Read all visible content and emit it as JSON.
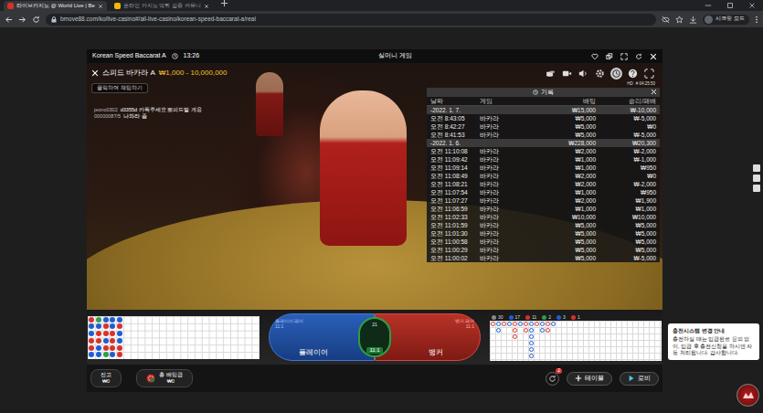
{
  "browser": {
    "tabs": [
      {
        "label": "라이브카지노 @ World Live | Be",
        "selected": true
      },
      {
        "label": "온라인 카지노 먹튀 검증 커뮤니",
        "selected": false
      }
    ],
    "url": "bmove88.com/ko/live-casino#/all-live-casino/korean-speed-baccarat-a/real",
    "profile": "시크릿 모드"
  },
  "game_header": {
    "title": "Korean Speed Baccarat A",
    "time": "13:26",
    "mode": "실머니 게임"
  },
  "table": {
    "name": "스피드 바카라 A",
    "limits": "₩1,000 - 10,000,000"
  },
  "chat": {
    "button": "클릭하여 채팅하기",
    "messages": [
      {
        "user": "jeono0302",
        "text": "d3355d 카톡주세요 뽀피드발 게용"
      },
      {
        "user": "00000087/5",
        "text": "나와라 좀"
      }
    ]
  },
  "stream": {
    "quality": "HD",
    "code": "# 04:25:50"
  },
  "history": {
    "open": true,
    "title": "기록",
    "columns": [
      "날짜",
      "게임",
      "배팅",
      "승리/패배"
    ],
    "rows": [
      {
        "kind": "group",
        "date": "-2022. 1. 7.",
        "bet": "₩15,000",
        "result": "₩-10,000"
      },
      {
        "kind": "entry",
        "time": "오전 8:43:05",
        "game": "바카라",
        "bet": "₩5,000",
        "result": "₩-5,000"
      },
      {
        "kind": "entry",
        "time": "오전 8:42:27",
        "game": "바카라",
        "bet": "₩5,000",
        "result": "₩0"
      },
      {
        "kind": "entry",
        "time": "오전 8:41:53",
        "game": "바카라",
        "bet": "₩5,000",
        "result": "₩-5,000"
      },
      {
        "kind": "group",
        "date": "-2022. 1. 6.",
        "bet": "₩228,000",
        "result": "₩20,300"
      },
      {
        "kind": "entry",
        "time": "오전 11:10:08",
        "game": "바카라",
        "bet": "₩2,000",
        "result": "₩-2,000"
      },
      {
        "kind": "entry",
        "time": "오전 11:09:42",
        "game": "바카라",
        "bet": "₩1,000",
        "result": "₩-1,000"
      },
      {
        "kind": "entry",
        "time": "오전 11:09:14",
        "game": "바카라",
        "bet": "₩1,000",
        "result": "₩950"
      },
      {
        "kind": "entry",
        "time": "오전 11:08:49",
        "game": "바카라",
        "bet": "₩2,000",
        "result": "₩0"
      },
      {
        "kind": "entry",
        "time": "오전 11:08:21",
        "game": "바카라",
        "bet": "₩2,000",
        "result": "₩-2,000"
      },
      {
        "kind": "entry",
        "time": "오전 11:07:54",
        "game": "바카라",
        "bet": "₩1,000",
        "result": "₩950"
      },
      {
        "kind": "entry",
        "time": "오전 11:07:27",
        "game": "바카라",
        "bet": "₩2,000",
        "result": "₩1,900"
      },
      {
        "kind": "entry",
        "time": "오전 11:06:59",
        "game": "바카라",
        "bet": "₩1,000",
        "result": "₩1,000"
      },
      {
        "kind": "entry",
        "time": "오전 11:02:33",
        "game": "바카라",
        "bet": "₩10,000",
        "result": "₩10,000"
      },
      {
        "kind": "entry",
        "time": "오전 11:01:59",
        "game": "바카라",
        "bet": "₩5,000",
        "result": "₩5,000"
      },
      {
        "kind": "entry",
        "time": "오전 11:01:30",
        "game": "바카라",
        "bet": "₩5,000",
        "result": "₩5,000"
      },
      {
        "kind": "entry",
        "time": "오전 11:00:58",
        "game": "바카라",
        "bet": "₩5,000",
        "result": "₩5,000"
      },
      {
        "kind": "entry",
        "time": "오전 11:00:29",
        "game": "바카라",
        "bet": "₩5,000",
        "result": "₩5,000"
      },
      {
        "kind": "entry",
        "time": "오전 11:00:02",
        "game": "바카라",
        "bet": "₩5,000",
        "result": "₩-5,000"
      }
    ]
  },
  "bead_road": [
    {
      "color": "#d8322b"
    },
    {
      "color": "#1d5fd1"
    },
    {
      "color": "#1d5fd1"
    },
    {
      "color": "#d8322b"
    },
    {
      "color": "#d8322b"
    },
    {
      "color": "#1d5fd1"
    },
    {
      "color": "#2f9e44"
    },
    {
      "color": "#1d5fd1"
    },
    {
      "color": "#d8322b"
    },
    {
      "color": "#d8322b"
    },
    {
      "color": "#1d5fd1"
    },
    {
      "color": "#1d5fd1"
    },
    {
      "color": "#1d5fd1"
    },
    {
      "color": "#d8322b"
    },
    {
      "color": "#d8322b"
    },
    {
      "color": "#1d5fd1"
    },
    {
      "color": "#d8322b"
    },
    {
      "color": "#2f9e44"
    },
    {
      "color": "#1d5fd1"
    },
    {
      "color": "#1d5fd1"
    },
    {
      "color": "#d8322b"
    },
    {
      "color": "#d8322b"
    },
    {
      "color": "#d8322b"
    },
    {
      "color": "#1d5fd1"
    },
    {
      "color": "#1d5fd1"
    },
    {
      "color": "#d8322b"
    },
    {
      "color": "#1d5fd1"
    },
    {
      "color": "#1d5fd1"
    },
    {
      "color": "#d8322b"
    },
    {
      "color": "#d8322b"
    }
  ],
  "road_stats": [
    {
      "value": "30",
      "color": "#8a8a8a"
    },
    {
      "value": "17",
      "color": "#1d5fd1"
    },
    {
      "value": "11",
      "color": "#d8322b"
    },
    {
      "value": "2",
      "color": "#2f9e44"
    },
    {
      "value": "3",
      "color": "#1d5fd1"
    },
    {
      "value": "1",
      "color": "#d8322b"
    }
  ],
  "big_road": [
    {
      "color": "#d8322b",
      "count": 1
    },
    {
      "color": "#1d5fd1",
      "count": 2
    },
    {
      "color": "#d8322b",
      "count": 1
    },
    {
      "color": "#1d5fd1",
      "count": 1
    },
    {
      "color": "#d8322b",
      "count": 3
    },
    {
      "color": "#1d5fd1",
      "count": 1
    },
    {
      "color": "#d8322b",
      "count": 2
    },
    {
      "color": "#1d5fd1",
      "count": 6
    },
    {
      "color": "#d8322b",
      "count": 1
    },
    {
      "color": "#1d5fd1",
      "count": 2
    },
    {
      "color": "#d8322b",
      "count": 2
    },
    {
      "color": "#1d5fd1",
      "count": 1
    }
  ],
  "bets": {
    "player": {
      "label": "플레이어",
      "pair": "플레이어 페어",
      "pair_payout": "11:1"
    },
    "tie": {
      "pct": "21",
      "payout": "11:1"
    },
    "banker": {
      "label": "뱅커",
      "pair": "뱅커 페어",
      "pair_payout": "11:1"
    }
  },
  "footer": {
    "balance_label": "잔고",
    "balance": "₩0",
    "bet_label": "총 배팅금",
    "bet": "₩0",
    "badge": "2",
    "table_button": "테이블",
    "lobby_button": "로비"
  },
  "notice": {
    "title": "충전시스템 변경 안내",
    "body": "충전하실 때는 입금완료 문의 없이, 입금 후 충전신청을 하시면 자동 처리됩니다. 감사합니다."
  }
}
